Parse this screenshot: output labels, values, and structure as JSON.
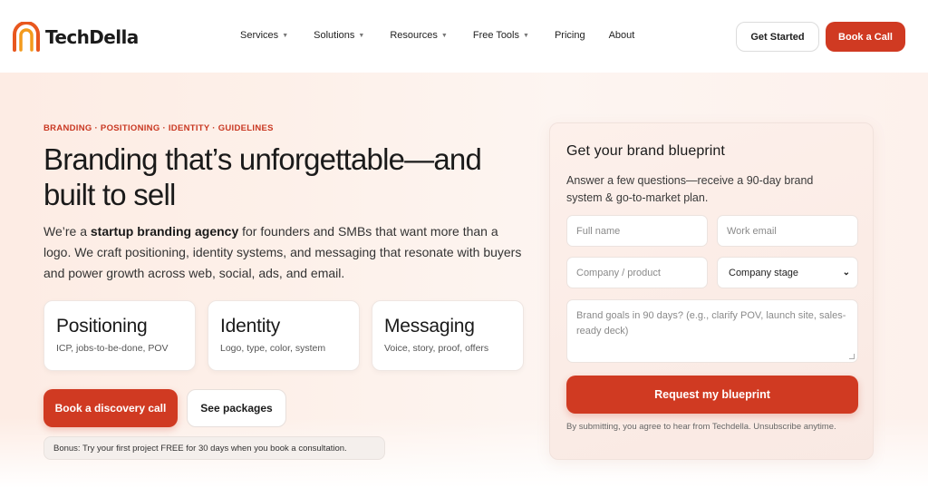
{
  "brand": {
    "name": "TechDella",
    "logo_icon": "arch-logo-icon",
    "accent_color": "#d03a22",
    "logo_colors": [
      "#e8571e",
      "#f39a1c"
    ]
  },
  "nav": {
    "items": [
      {
        "label": "Services",
        "has_dropdown": true
      },
      {
        "label": "Solutions",
        "has_dropdown": true
      },
      {
        "label": "Resources",
        "has_dropdown": true
      },
      {
        "label": "Free Tools",
        "has_dropdown": true
      },
      {
        "label": "Pricing",
        "has_dropdown": false
      },
      {
        "label": "About",
        "has_dropdown": false
      }
    ],
    "dropdown_icon": "chevron-down-icon",
    "get_started": "Get Started",
    "book_call": "Book a Call"
  },
  "hero": {
    "eyebrow": "BRANDING · POSITIONING · IDENTITY · GUIDELINES",
    "headline": "Branding that’s unforgettable—and built to sell",
    "lead": {
      "before": "We’re a ",
      "bold": "startup branding agency",
      "after": " for founders and SMBs that want more than a logo. We craft positioning, identity systems, and messaging that resonate with buyers and power growth across web, social, ads, and email."
    },
    "features": [
      {
        "title": "Positioning",
        "sub": "ICP, jobs-to-be-done, POV"
      },
      {
        "title": "Identity",
        "sub": "Logo, type, color, system"
      },
      {
        "title": "Messaging",
        "sub": "Voice, story, proof, offers"
      }
    ],
    "cta_primary": "Book a discovery call",
    "cta_secondary": "See packages",
    "bonus": "Bonus: Try your first project FREE for 30 days when you book a consultation."
  },
  "form": {
    "title": "Get your brand blueprint",
    "description": "Answer a few questions—receive a 90-day brand system & go-to-market plan.",
    "full_name_placeholder": "Full name",
    "work_email_placeholder": "Work email",
    "company_placeholder": "Company / product",
    "stage_selected": "Company stage",
    "goals_placeholder": "Brand goals in 90 days? (e.g., clarify POV, launch site, sales-ready deck)",
    "submit": "Request my blueprint",
    "disclaimer": "By submitting, you agree to hear from Techdella. Unsubscribe anytime."
  }
}
